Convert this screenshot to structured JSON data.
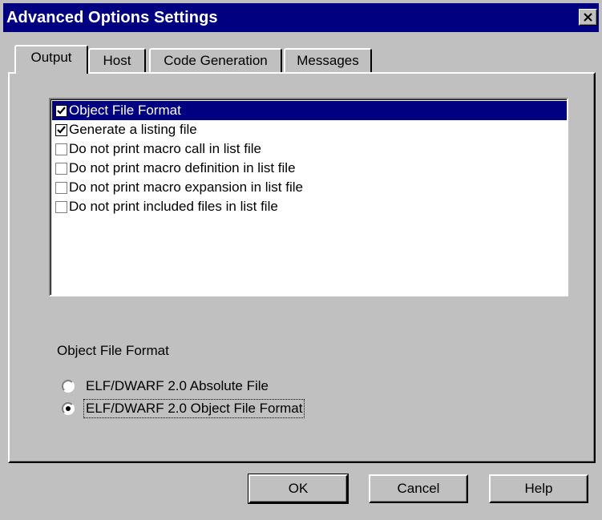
{
  "window": {
    "title": "Advanced Options Settings"
  },
  "tabs": [
    {
      "label": "Output",
      "active": true
    },
    {
      "label": "Host",
      "active": false
    },
    {
      "label": "Code Generation",
      "active": false
    },
    {
      "label": "Messages",
      "active": false
    }
  ],
  "options_list": {
    "items": [
      {
        "label": "Object File Format",
        "checked": true,
        "selected": true
      },
      {
        "label": "Generate a listing file",
        "checked": true,
        "selected": false
      },
      {
        "label": "Do not print macro call in list file",
        "checked": false,
        "selected": false
      },
      {
        "label": "Do not print macro definition in list file",
        "checked": false,
        "selected": false
      },
      {
        "label": "Do not print macro expansion in list file",
        "checked": false,
        "selected": false
      },
      {
        "label": "Do not print included files in list file",
        "checked": false,
        "selected": false
      }
    ]
  },
  "format_group": {
    "label": "Object File Format",
    "options": [
      {
        "label": "ELF/DWARF 2.0 Absolute File",
        "selected": false
      },
      {
        "label": "ELF/DWARF 2.0 Object File Format",
        "selected": true
      }
    ]
  },
  "buttons": {
    "ok": "OK",
    "cancel": "Cancel",
    "help": "Help"
  },
  "colors": {
    "title_bar": "#000080",
    "face": "#c0c0c0",
    "selection": "#000080"
  }
}
